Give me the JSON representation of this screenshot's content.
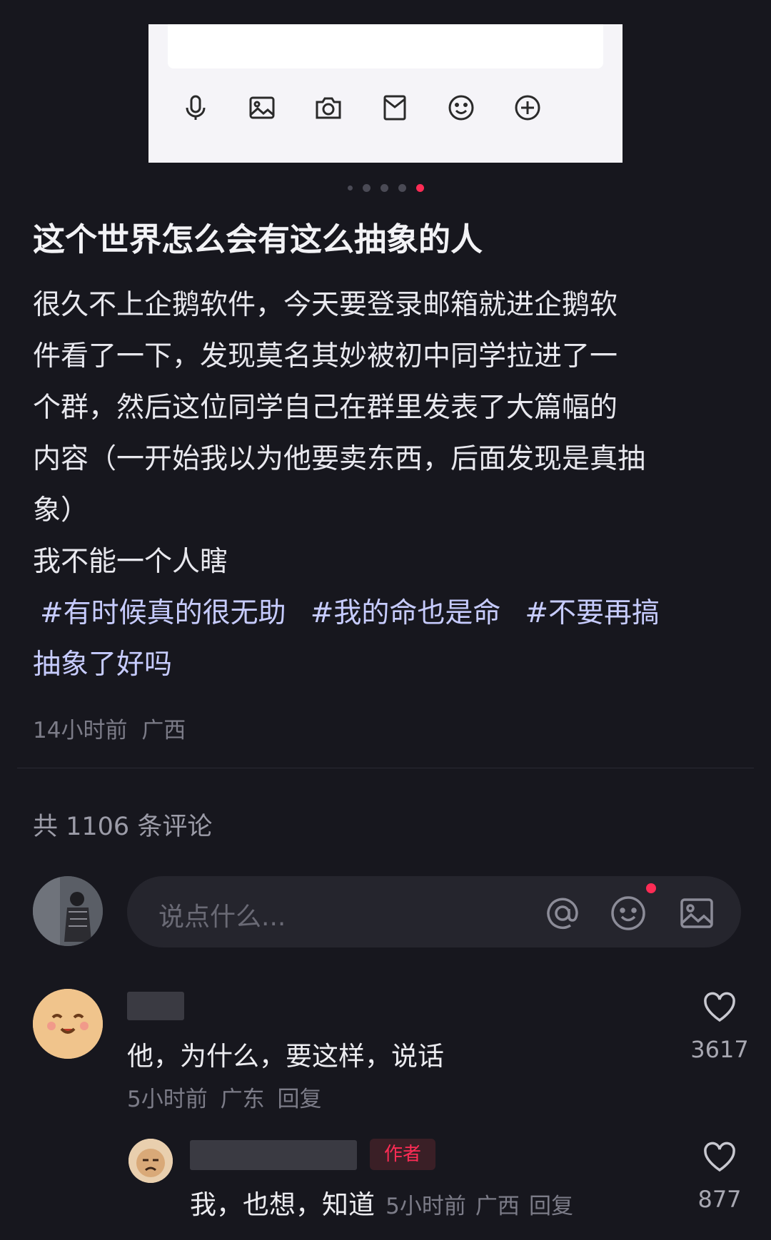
{
  "embed_toolbar": {
    "icons": [
      "microphone-icon",
      "image-icon",
      "camera-icon",
      "mail-icon",
      "emoji-icon",
      "plus-circle-icon"
    ]
  },
  "carousel": {
    "total": 5,
    "active_index": 4
  },
  "post": {
    "title": "这个世界怎么会有这么抽象的人",
    "body_lines": [
      "很久不上企鹅软件，今天要登录邮箱就进企鹅软",
      "件看了一下，发现莫名其妙被初中同学拉进了一",
      "个群，然后这位同学自己在群里发表了大篇幅的",
      "内容（一开始我以为他要卖东西，后面发现是真抽",
      "象）",
      "我不能一个人瞎"
    ],
    "tags_line1": [
      "#有时候真的很无助",
      "#我的命也是命",
      "#不要再搞"
    ],
    "tags_line2": "抽象了好吗",
    "time": "14小时前",
    "location": "广西"
  },
  "comments_header": {
    "count_text": "共 1106 条评论"
  },
  "comment_input": {
    "placeholder": "说点什么...",
    "icons": [
      "at-icon",
      "emoji-icon",
      "image-icon"
    ]
  },
  "comments": [
    {
      "text": "他，为什么，要这样，说话",
      "time": "5小时前",
      "location": "广东",
      "reply_label": "回复",
      "likes": "3617"
    },
    {
      "badge": "作者",
      "text": "我，也想，知道",
      "time": "5小时前",
      "location": "广西",
      "reply_label": "回复",
      "likes": "877"
    }
  ],
  "colors": {
    "accent": "#fe2c55",
    "background": "#17171e",
    "tag": "#c7ccff"
  }
}
